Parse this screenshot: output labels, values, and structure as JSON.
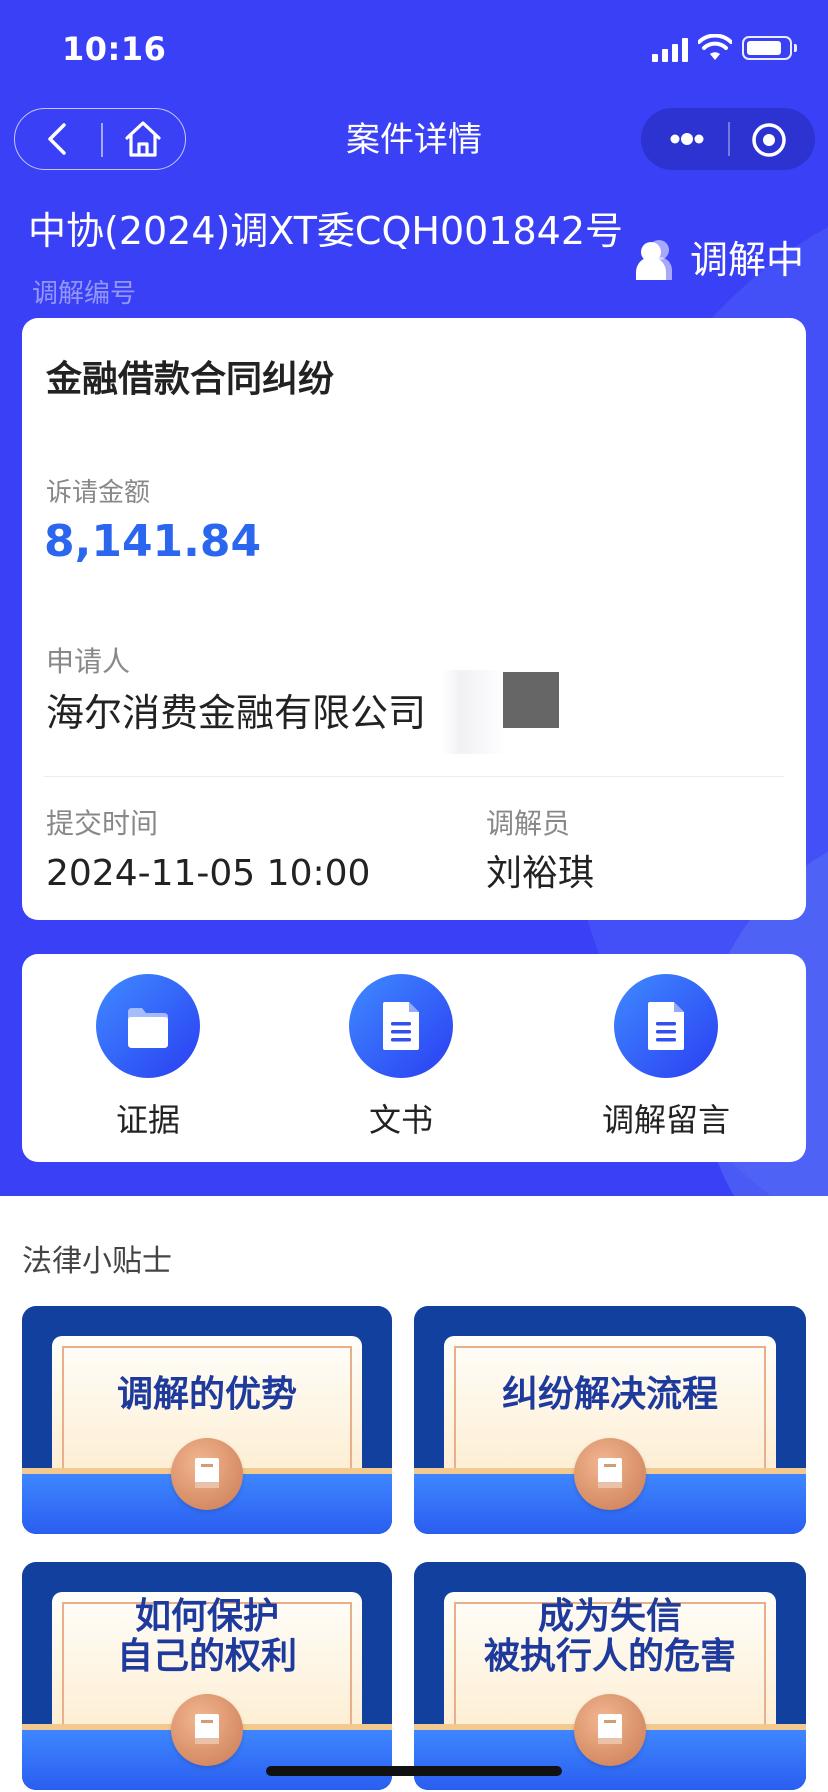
{
  "status_bar": {
    "time": "10:16"
  },
  "nav": {
    "title": "案件详情"
  },
  "case": {
    "number": "中协(2024)调XT委CQH001842号",
    "number_label": "调解编号",
    "status": "调解中",
    "type": "纠纷",
    "type_full": "金融借款合同纠纷",
    "amount_label": "诉请金额",
    "amount": "8,141.84",
    "applicant_label": "申请人",
    "applicant": "海尔消费金融有限公司",
    "submit_time_label": "提交时间",
    "submit_time": "2024-11-05 10:00",
    "mediator_label": "调解员",
    "mediator": "刘裕琪"
  },
  "actions": [
    {
      "label": "证据",
      "icon": "folder-icon"
    },
    {
      "label": "文书",
      "icon": "document-icon"
    },
    {
      "label": "调解留言",
      "icon": "message-document-icon"
    }
  ],
  "tips": {
    "title": "法律小贴士",
    "items": [
      {
        "text": "调解的优势"
      },
      {
        "text": "纠纷解决流程"
      },
      {
        "text": "如何保护\n自己的权利"
      },
      {
        "text": "成为失信\n被执行人的危害"
      }
    ]
  },
  "colors": {
    "primary": "#3a40f5",
    "amount": "#2a66ee",
    "tip_text": "#1d3a9c"
  }
}
